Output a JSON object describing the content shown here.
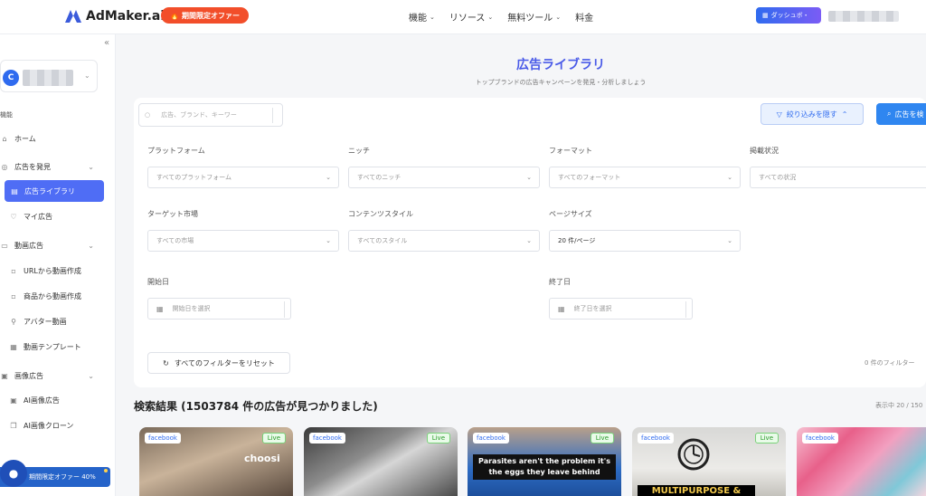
{
  "header": {
    "logo_text": "AdMaker.ai",
    "promo_label": "期間限定オファー",
    "nav": [
      {
        "label": "機能"
      },
      {
        "label": "リソース"
      },
      {
        "label": "無料ツール"
      },
      {
        "label": "料金"
      }
    ],
    "dashboard_label": "ダッシュボ・"
  },
  "sidebar": {
    "section_features": "機能",
    "items": [
      {
        "label": "ホーム"
      },
      {
        "label": "広告を発見"
      },
      {
        "label": "広告ライブラリ"
      },
      {
        "label": "マイ広告"
      },
      {
        "label": "動画広告"
      },
      {
        "label": "URLから動画作成"
      },
      {
        "label": "商品から動画作成"
      },
      {
        "label": "アバター動画"
      },
      {
        "label": "動画テンプレート"
      },
      {
        "label": "画像広告"
      },
      {
        "label": "AI画像広告"
      },
      {
        "label": "AI画像クローン"
      }
    ],
    "offer_label": "期間限定オファー 40%",
    "avatar_letter": "C"
  },
  "main": {
    "title": "広告ライブラリ",
    "subtitle": "トップブランドの広告キャンペーンを発見・分析しましょう",
    "search_placeholder": "広告、ブランド、キーワー",
    "hide_filters_label": "絞り込みを隠す",
    "search_button_label": "広告を検",
    "filters": {
      "platform": {
        "label": "プラットフォーム",
        "value": "すべてのプラットフォーム"
      },
      "niche": {
        "label": "ニッチ",
        "value": "すべてのニッチ"
      },
      "format": {
        "label": "フォーマット",
        "value": "すべてのフォーマット"
      },
      "status": {
        "label": "掲載状況",
        "value": "すべての状況"
      },
      "market": {
        "label": "ターゲット市場",
        "value": "すべての市場"
      },
      "content_style": {
        "label": "コンテンツスタイル",
        "value": "すべてのスタイル"
      },
      "page_size": {
        "label": "ページサイズ",
        "value": "20 件/ページ"
      },
      "start_date": {
        "label": "開始日",
        "placeholder": "開始日を選択"
      },
      "end_date": {
        "label": "終了日",
        "placeholder": "終了日を選択"
      }
    },
    "reset_label": "すべてのフィルターをリセット",
    "filter_count": "0 件のフィルター",
    "results_title": "検索結果 (1503784 件の広告が見つかりました)",
    "showing": "表示中 20 / 150"
  },
  "cards": [
    {
      "platform": "facebook",
      "status": "Live",
      "caption": "choosi"
    },
    {
      "platform": "facebook",
      "status": "Live",
      "caption": ""
    },
    {
      "platform": "facebook",
      "status": "Live",
      "caption": "Parasites aren't the problem it's the eggs they leave behind"
    },
    {
      "platform": "facebook",
      "status": "Live",
      "caption": "MULTIPURPOSE &"
    },
    {
      "platform": "facebook",
      "status": "",
      "caption": ""
    }
  ],
  "colors": {
    "accent": "#4f6df5",
    "title": "#4a5be8",
    "promo": "#f24e2a",
    "search_button": "#2f86f0"
  }
}
